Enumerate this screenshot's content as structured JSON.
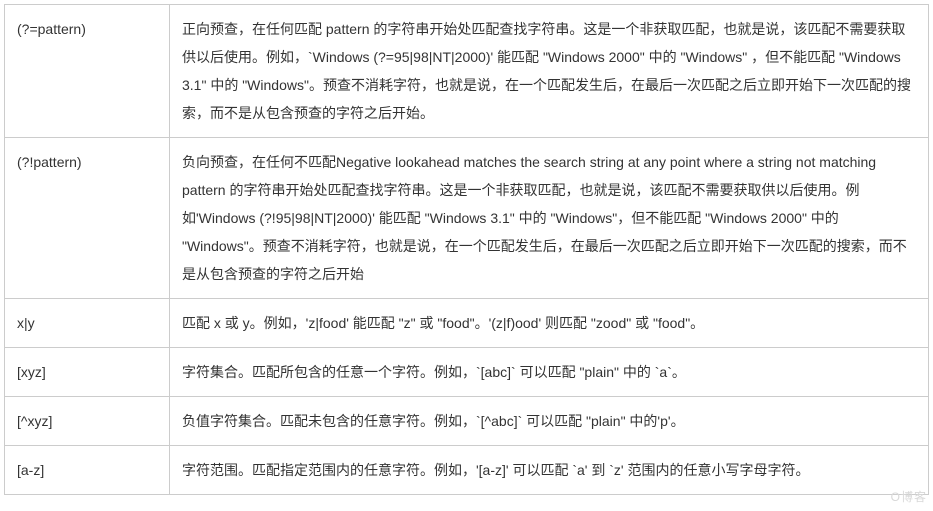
{
  "rows": [
    {
      "pattern": "(?=pattern)",
      "desc": "正向预查，在任何匹配 pattern 的字符串开始处匹配查找字符串。这是一个非获取匹配，也就是说，该匹配不需要获取供以后使用。例如，`Windows (?=95|98|NT|2000)' 能匹配 \"Windows 2000\" 中的 \"Windows\" ，但不能匹配 \"Windows 3.1\" 中的 \"Windows\"。预查不消耗字符，也就是说，在一个匹配发生后，在最后一次匹配之后立即开始下一次匹配的搜索，而不是从包含预查的字符之后开始。"
    },
    {
      "pattern": "(?!pattern)",
      "desc": "负向预查，在任何不匹配Negative lookahead matches the search string at any point where a string not matching pattern 的字符串开始处匹配查找字符串。这是一个非获取匹配，也就是说，该匹配不需要获取供以后使用。例如'Windows (?!95|98|NT|2000)' 能匹配 \"Windows 3.1\" 中的 \"Windows\"，但不能匹配 \"Windows 2000\" 中的 \"Windows\"。预查不消耗字符，也就是说，在一个匹配发生后，在最后一次匹配之后立即开始下一次匹配的搜索，而不是从包含预查的字符之后开始"
    },
    {
      "pattern": "x|y",
      "desc": "匹配 x 或 y。例如，'z|food' 能匹配 \"z\" 或 \"food\"。'(z|f)ood' 则匹配 \"zood\" 或 \"food\"。"
    },
    {
      "pattern": "[xyz]",
      "desc": "字符集合。匹配所包含的任意一个字符。例如，`[abc]` 可以匹配 \"plain\" 中的 `a`。"
    },
    {
      "pattern": "[^xyz]",
      "desc": "负值字符集合。匹配未包含的任意字符。例如，`[^abc]` 可以匹配 \"plain\" 中的'p'。"
    },
    {
      "pattern": "[a-z]",
      "desc": "字符范围。匹配指定范围内的任意字符。例如，'[a-z]' 可以匹配 `a' 到 `z' 范围内的任意小写字母字符。"
    }
  ],
  "watermark": "O博客"
}
